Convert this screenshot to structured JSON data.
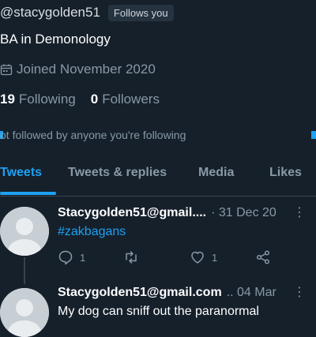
{
  "profile": {
    "handle": "@stacygolden51",
    "follows_you": "Follows you",
    "bio": "BA in Demonology",
    "joined": "Joined November 2020",
    "following_count": "19",
    "following_label": "Following",
    "followers_count": "0",
    "followers_label": "Followers",
    "not_followed_note": "ot followed by anyone you're following"
  },
  "tabs": [
    {
      "label": "Tweets",
      "active": true
    },
    {
      "label": "Tweets & replies",
      "active": false
    },
    {
      "label": "Media",
      "active": false
    },
    {
      "label": "Likes",
      "active": false
    }
  ],
  "tweets": [
    {
      "name": "Stacygolden51@gmail....",
      "date": "· 31 Dec 20",
      "text": "#zakbagans",
      "reply_count": "1",
      "like_count": "1"
    },
    {
      "name": "Stacygolden51@gmail.com",
      "date": ".. 04 Mar",
      "text": "My dog can sniff out the paranormal"
    }
  ],
  "icons": {
    "more": "more-icon",
    "reply": "reply-icon",
    "retweet": "retweet-icon",
    "like": "like-icon",
    "share": "share-icon",
    "calendar": "calendar-icon"
  },
  "colors": {
    "background": "#15202b",
    "accent": "#1da1f2",
    "muted_text": "#8899a6",
    "divider": "#38444d"
  }
}
